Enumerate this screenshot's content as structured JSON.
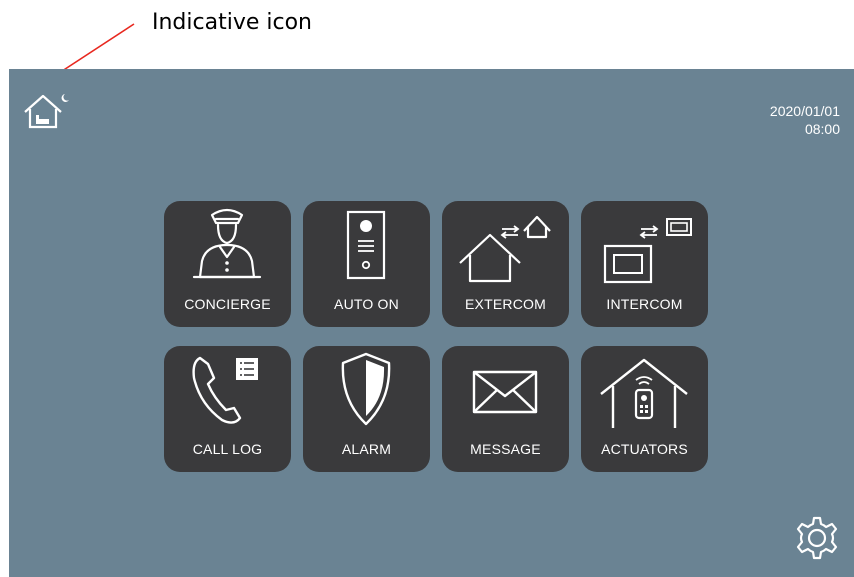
{
  "annotation": {
    "text": "Indicative icon",
    "arrow_color": "#e8281f"
  },
  "status": {
    "mode_icon": "home-night-icon",
    "date": "2020/01/01",
    "time": "08:00"
  },
  "menu": {
    "tiles": [
      {
        "label": "CONCIERGE",
        "icon": "concierge-icon"
      },
      {
        "label": "AUTO ON",
        "icon": "door-station-icon"
      },
      {
        "label": "EXTERCOM",
        "icon": "extercom-icon"
      },
      {
        "label": "INTERCOM",
        "icon": "intercom-icon"
      },
      {
        "label": "CALL LOG",
        "icon": "call-log-icon"
      },
      {
        "label": "ALARM",
        "icon": "alarm-shield-icon"
      },
      {
        "label": "MESSAGE",
        "icon": "message-envelope-icon"
      },
      {
        "label": "ACTUATORS",
        "icon": "actuators-icon"
      }
    ]
  },
  "settings": {
    "icon": "gear-icon"
  },
  "colors": {
    "screen_bg": "#6a8393",
    "tile_bg": "#3a3a3c",
    "foreground": "#ffffff"
  }
}
